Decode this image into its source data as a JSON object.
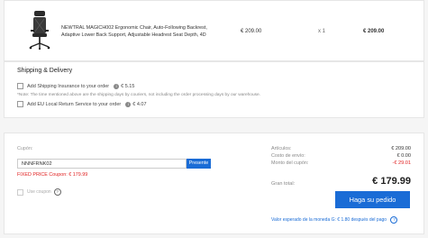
{
  "product": {
    "name": "NEWTRAL MAGICH002 Ergonomic Chair, Auto-Following Backrest, Adaptive Lower Back Support, Adjustable Headrest Seat Depth, 4D",
    "price": "€ 209.00",
    "quantity": "x 1",
    "total": "€ 209.00",
    "image_icon": "office-chair"
  },
  "shipping": {
    "title": "Shipping & Delivery",
    "insurance_label": "Add Shipping Insurance to your order",
    "insurance_price": "€ 5.15",
    "note": "*Note: The time mentioned above are the shipping days by couriers, not including the order processing days by our warehouse.",
    "return_label": "Add EU Local Return Service to your order",
    "return_price": "€ 4.07"
  },
  "coupon": {
    "label": "Cupón:",
    "value": "NNNFRNK02",
    "button": "Presente",
    "fixed_price": "FIXED PRICE Coupon: € 179.99",
    "use_label": "Use coupon"
  },
  "summary": {
    "articles_label": "Artículos:",
    "articles_value": "€ 209.00",
    "shipping_label": "Costo de envío:",
    "shipping_value": "€ 0.00",
    "coupon_label": "Monto del cupón:",
    "coupon_value": "-€ 29.01",
    "grand_label": "Gran total:",
    "grand_value": "€ 179.99",
    "place_order": "Haga su pedido",
    "expected": "Valor esperado de la moneda G: € 1.80 después del pago",
    "accent": "#1a6cd6",
    "discount_color": "#e02020"
  }
}
